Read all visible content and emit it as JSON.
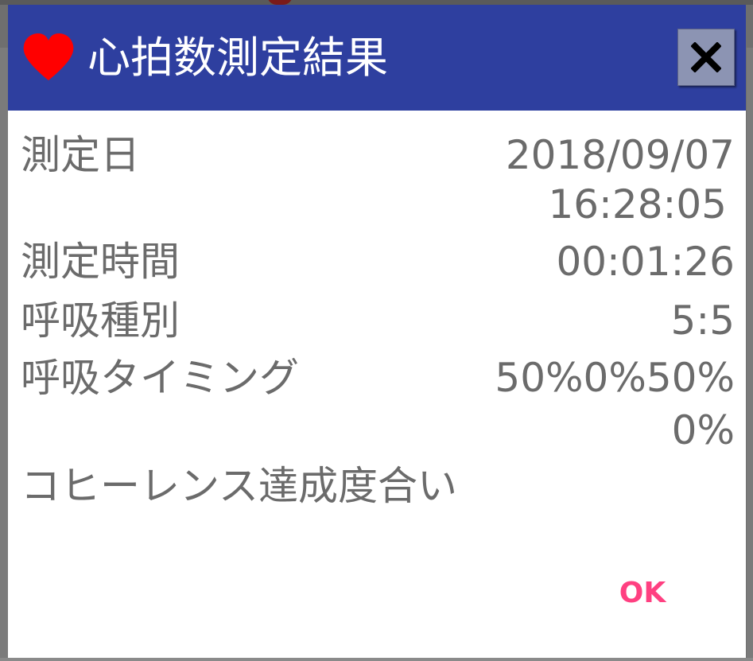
{
  "dialog": {
    "title": "心拍数測定結果",
    "heart_color": "#ff0000",
    "header_color": "#2e3f9f",
    "close_icon": "close-icon",
    "rows": {
      "date": {
        "label": "測定日",
        "value_line1": "2018/09/07",
        "value_line2": "16:28:05"
      },
      "duration": {
        "label": "測定時間",
        "value": "00:01:26"
      },
      "breath_type": {
        "label": "呼吸種別",
        "value": "5:5"
      },
      "breath_timing": {
        "label": "呼吸タイミング",
        "value_line1": "50%0%50%",
        "value_line2": "0%"
      },
      "coherence": {
        "label": "コヒーレンス達成度合い",
        "value": ""
      }
    },
    "ok_label": "OK",
    "ok_color": "#ff4081"
  }
}
